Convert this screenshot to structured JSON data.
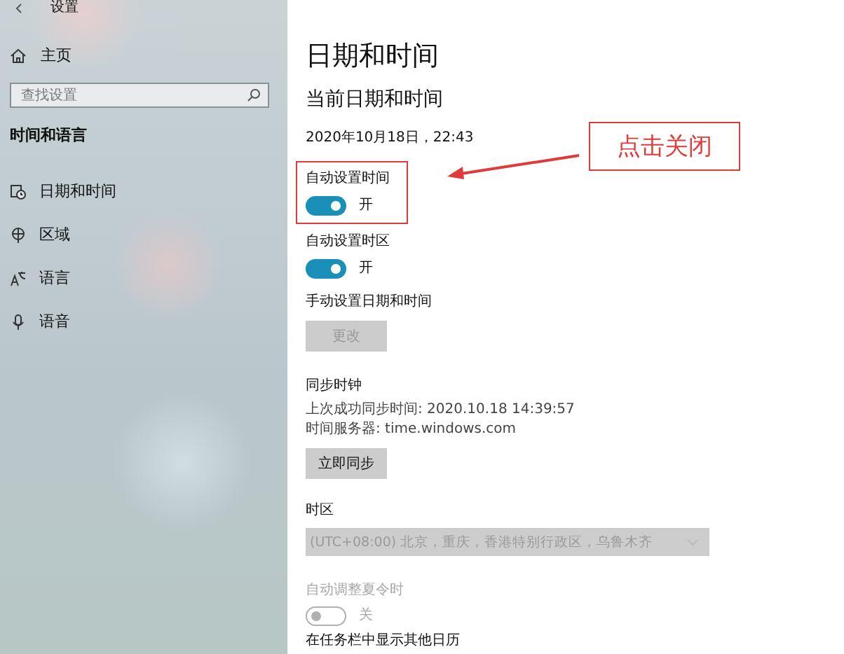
{
  "window": {
    "title": "设置"
  },
  "sidebar": {
    "home": "主页",
    "search": {
      "placeholder": "查找设置"
    },
    "section": "时间和语言",
    "items": [
      {
        "label": "日期和时间",
        "kind": "clock"
      },
      {
        "label": "区域",
        "kind": "globe"
      },
      {
        "label": "语言",
        "kind": "language"
      },
      {
        "label": "语音",
        "kind": "mic"
      }
    ]
  },
  "main": {
    "title": "日期和时间",
    "subtitle": "当前日期和时间",
    "current_datetime": "2020年10月18日，22:43",
    "auto_time": {
      "label": "自动设置时间",
      "on": true,
      "state": "开"
    },
    "auto_timezone": {
      "label": "自动设置时区",
      "on": true,
      "state": "开"
    },
    "manual": {
      "label": "手动设置日期和时间",
      "button": "更改",
      "disabled": true
    },
    "sync": {
      "heading": "同步时钟",
      "last_sync": "上次成功同步时间: 2020.10.18 14:39:57",
      "server": "时间服务器: time.windows.com",
      "button": "立即同步"
    },
    "timezone": {
      "label": "时区",
      "value": "(UTC+08:00) 北京，重庆，香港特别行政区，乌鲁木齐",
      "disabled": true
    },
    "dst": {
      "label": "自动调整夏令时",
      "on": false,
      "state": "关",
      "disabled": true
    },
    "taskbar_calendar": {
      "label": "在任务栏中显示其他日历"
    }
  },
  "annotation": {
    "label": "点击关闭"
  }
}
